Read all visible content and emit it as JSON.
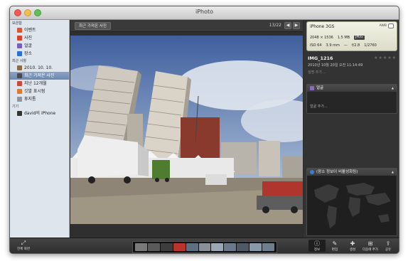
{
  "window": {
    "title": "iPhoto"
  },
  "sidebar": {
    "sections": [
      {
        "label": "보관함",
        "items": [
          {
            "label": "이벤트",
            "icon": "events-icon",
            "color": "#e0542e"
          },
          {
            "label": "사진",
            "icon": "photos-icon",
            "color": "#d8432f"
          },
          {
            "label": "얼굴",
            "icon": "faces-icon",
            "color": "#7b5cc0"
          },
          {
            "label": "장소",
            "icon": "places-icon",
            "color": "#2d6fd3"
          }
        ]
      },
      {
        "label": "최근 사항",
        "items": [
          {
            "label": "2010. 10. 10.",
            "icon": "event-thumb-icon",
            "color": "#8a6b4a"
          },
          {
            "label": "최근 가져온 사진",
            "icon": "last-import-icon",
            "color": "#4b4b4b",
            "selected": true
          },
          {
            "label": "지난 12개월",
            "icon": "calendar-icon",
            "color": "#c94a3c"
          },
          {
            "label": "깃발 표시됨",
            "icon": "flag-icon",
            "color": "#e07a28"
          },
          {
            "label": "휴지통",
            "icon": "trash-icon",
            "color": "#8d96a1"
          }
        ]
      },
      {
        "label": "기기",
        "items": [
          {
            "label": "david의 iPhone",
            "icon": "iphone-icon",
            "color": "#333333"
          }
        ]
      }
    ]
  },
  "viewer": {
    "back_label": "최근 가져온 사진",
    "counter": "13/22",
    "prev_glyph": "◀",
    "next_glyph": "▶"
  },
  "info": {
    "camera": {
      "model": "iPhone 3GS",
      "wb": "AWB",
      "dimensions": "2048 × 1536",
      "filesize": "1.5 MB",
      "format": "JPEG",
      "iso": "ISO 64",
      "focal": "3.9 mm",
      "exposure_comp": "—",
      "aperture": "f/2.8",
      "shutter": "1/2760"
    },
    "name": "IMG_1216",
    "date": "2010년 10월 20일 오전 11:14:49",
    "add_description": "설명 추가...",
    "faces_panel": {
      "title": "얼굴",
      "body": "얼굴 추가..."
    },
    "places_panel": {
      "title": "(장소 정보이 비활성화됨)"
    }
  },
  "bottombar": {
    "fullscreen_label": "전체 화면",
    "tools": [
      {
        "label": "정보",
        "icon": "info-icon",
        "glyph": "ⓘ",
        "active": true
      },
      {
        "label": "편집",
        "icon": "edit-pencil-icon",
        "glyph": "✎"
      },
      {
        "label": "생성",
        "icon": "create-icon",
        "glyph": "✚"
      },
      {
        "label": "다음에 추가",
        "icon": "add-to-icon",
        "glyph": "⊞"
      },
      {
        "label": "공유",
        "icon": "share-icon",
        "glyph": "⇪"
      }
    ],
    "thumbnails": [
      "#7a7a7a",
      "#5a5a5a",
      "#3d3d3d",
      "#b8342d",
      "#5f6f82",
      "#8a8f98",
      "#9aa7b6",
      "#6a7a8c",
      "#4f5966",
      "#8899aa",
      "#6f7e8f"
    ]
  }
}
